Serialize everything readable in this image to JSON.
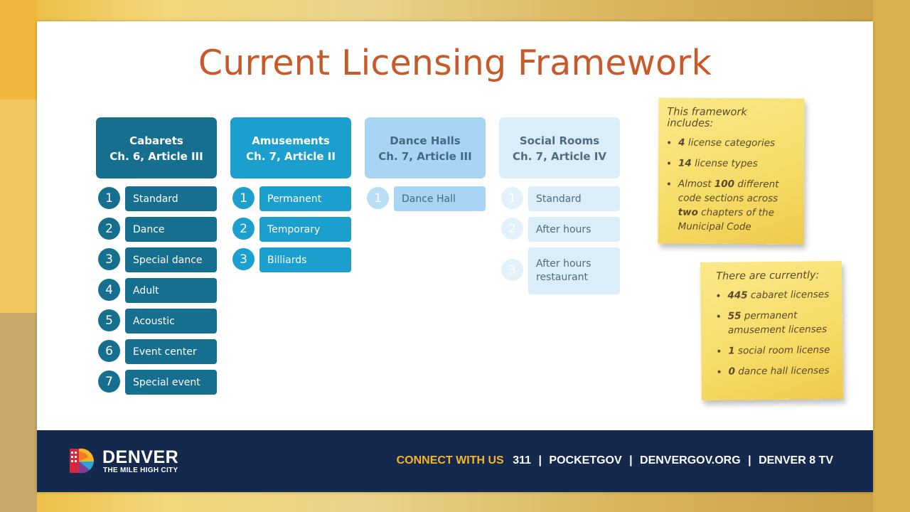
{
  "slide": {
    "title": "Current Licensing Framework"
  },
  "columns": [
    {
      "title": "Cabarets",
      "subtitle": "Ch. 6, Article III",
      "items": [
        {
          "num": "1",
          "label": "Standard"
        },
        {
          "num": "2",
          "label": "Dance"
        },
        {
          "num": "3",
          "label": "Special dance"
        },
        {
          "num": "4",
          "label": "Adult"
        },
        {
          "num": "5",
          "label": "Acoustic"
        },
        {
          "num": "6",
          "label": "Event center"
        },
        {
          "num": "7",
          "label": "Special event"
        }
      ]
    },
    {
      "title": "Amusements",
      "subtitle": "Ch. 7, Article II",
      "items": [
        {
          "num": "1",
          "label": "Permanent"
        },
        {
          "num": "2",
          "label": "Temporary"
        },
        {
          "num": "3",
          "label": "Billiards"
        }
      ]
    },
    {
      "title": "Dance Halls",
      "subtitle": "Ch. 7, Article III",
      "items": [
        {
          "num": "1",
          "label": "Dance Hall"
        }
      ]
    },
    {
      "title": "Social Rooms",
      "subtitle": "Ch. 7, Article IV",
      "items": [
        {
          "num": "1",
          "label": "Standard"
        },
        {
          "num": "2",
          "label": "After hours"
        },
        {
          "num": "3",
          "label": "After hours restaurant"
        }
      ]
    }
  ],
  "note1": {
    "heading": "This framework includes:",
    "items": [
      {
        "bold": "4",
        "text": " license categories"
      },
      {
        "bold": "14",
        "text": " license types"
      },
      {
        "pre": "Almost ",
        "bold": "100",
        "mid": " different code sections across ",
        "bold2": "two",
        "post": " chapters of the Municipal Code"
      }
    ]
  },
  "note2": {
    "heading": "There are currently:",
    "items": [
      {
        "bold": "445",
        "text": " cabaret licenses"
      },
      {
        "bold": "55",
        "text": " permanent amusement licenses"
      },
      {
        "bold": "1",
        "text": " social room license"
      },
      {
        "bold": "0",
        "text": " dance hall licenses"
      }
    ]
  },
  "footer": {
    "brand": "DENVER",
    "tagline": "THE MILE HIGH CITY",
    "connect": "CONNECT WITH US",
    "links": [
      "311",
      "POCKETGOV",
      "DENVERGOV.ORG",
      "DENVER 8 TV"
    ]
  },
  "colors": {
    "title": "#c85a2a",
    "cabarets": "#166f8e",
    "amusements": "#1b9fcf",
    "dance_halls": "#a8d5f3",
    "social_rooms": "#daedf8",
    "note": "#f6db66",
    "footer": "#14294d",
    "connect_accent": "#f4b626"
  }
}
